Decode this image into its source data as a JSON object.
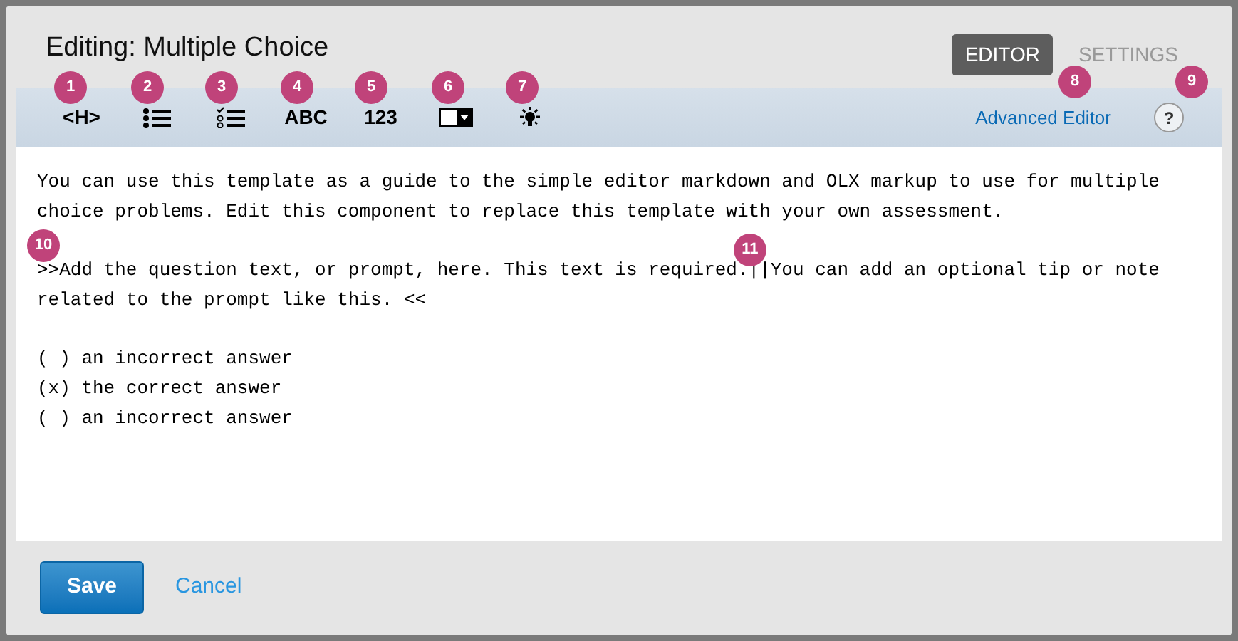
{
  "title": "Editing: Multiple Choice",
  "tabs": [
    {
      "label": "EDITOR",
      "selected": true
    },
    {
      "label": "SETTINGS",
      "selected": false
    }
  ],
  "toolbar": [
    {
      "kind": "text",
      "label": "<H>"
    },
    {
      "kind": "bullets"
    },
    {
      "kind": "checklist"
    },
    {
      "kind": "text",
      "label": "ABC"
    },
    {
      "kind": "text",
      "label": "123"
    },
    {
      "kind": "dropdown"
    },
    {
      "kind": "bulb"
    }
  ],
  "advanced_link": "Advanced Editor",
  "help": "?",
  "editor": {
    "paragraphs": [
      "You can use this template as a guide to the simple editor markdown and OLX markup to use for multiple choice problems. Edit this component to replace this template with your own assessment.",
      ">>Add the question text, or prompt, here. This text is required.||You can add an optional tip or note related to the prompt like this. <<"
    ],
    "answers": [
      "( ) an incorrect answer",
      "(x) the correct answer",
      "( ) an incorrect answer"
    ]
  },
  "badges": [
    "1",
    "2",
    "3",
    "4",
    "5",
    "6",
    "7",
    "8",
    "9",
    "10",
    "11"
  ],
  "buttons": {
    "save": "Save",
    "cancel": "Cancel"
  }
}
